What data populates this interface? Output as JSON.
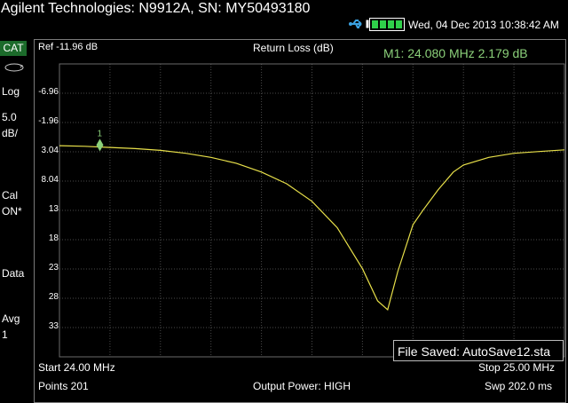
{
  "header": {
    "title": "Agilent Technologies: N9912A, SN: MY50493180",
    "datetime": "Wed, 04 Dec 2013 10:38:42 AM"
  },
  "sidebar": {
    "mode": "CAT",
    "format": "Log",
    "scale_value": "5.0",
    "scale_unit": "dB/",
    "cal_label": "Cal",
    "cal_state": "ON*",
    "data_label": "Data",
    "avg_label": "Avg",
    "avg_value": "1"
  },
  "display": {
    "reference": "Ref -11.96 dB",
    "trace_title": "Return Loss (dB)",
    "marker": "M1:  24.080 MHz   2.179 dB",
    "marker_number": "1",
    "y_ticks": [
      "-6.96",
      "-1.96",
      "3.04",
      "8.04",
      "13",
      "18",
      "23",
      "28",
      "33"
    ],
    "trace_color": "#e8e04a",
    "grid_color": "#4a4a4a"
  },
  "status": {
    "message": "File Saved: AutoSave12.sta"
  },
  "footer": {
    "start": "Start 24.00 MHz",
    "stop": "Stop 25.00 MHz",
    "points": "Points 201",
    "output_power": "Output Power: HIGH",
    "sweep": "Swp 202.0 ms"
  },
  "chart_data": {
    "type": "line",
    "title": "Return Loss (dB)",
    "x_start_mhz": 24.0,
    "x_stop_mhz": 25.0,
    "reference_db": -11.96,
    "scale_db_per_div": 5.0,
    "ylim": [
      -11.96,
      38.04
    ],
    "y_inverted": true,
    "x": [
      24.0,
      24.05,
      24.1,
      24.15,
      24.2,
      24.25,
      24.3,
      24.35,
      24.4,
      24.45,
      24.5,
      24.55,
      24.6,
      24.63,
      24.65,
      24.67,
      24.7,
      24.72,
      24.75,
      24.78,
      24.8,
      24.85,
      24.9,
      24.95,
      25.0
    ],
    "y": [
      2.0,
      2.1,
      2.3,
      2.5,
      2.8,
      3.3,
      4.0,
      5.0,
      6.5,
      8.5,
      11.5,
      16.0,
      23.0,
      28.5,
      30.0,
      23.5,
      15.5,
      13.0,
      9.5,
      6.5,
      5.3,
      4.0,
      3.3,
      3.0,
      2.7
    ],
    "markers": [
      {
        "name": "1",
        "x_mhz": 24.08,
        "y_db": 2.179
      }
    ]
  }
}
